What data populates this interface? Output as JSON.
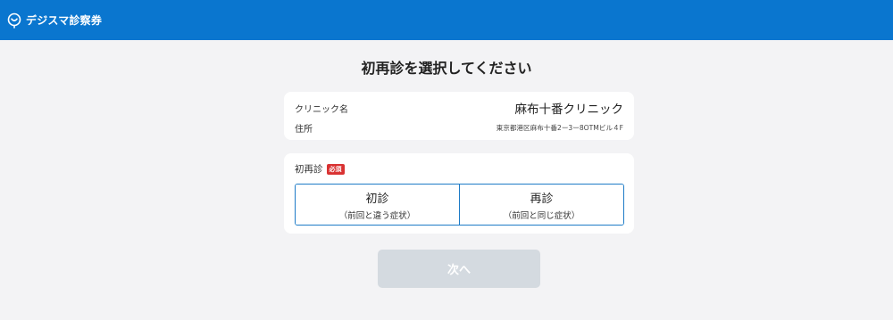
{
  "header": {
    "brand_name": "デジスマ診察券",
    "logo_icon": "location-pin-smile-icon",
    "background_color": "#0a76cf"
  },
  "page": {
    "title": "初再診を選択してください"
  },
  "clinic_info": {
    "clinic_label": "クリニック名",
    "clinic_name": "麻布十番クリニック",
    "address_label": "住所",
    "address": "東京都港区麻布十番2ー3ー8OTMビル４F"
  },
  "visit_type": {
    "label": "初再診",
    "required_badge": "必須",
    "required_color": "#d93232",
    "options": [
      {
        "title": "初診",
        "subtitle": "（前回と違う症状）"
      },
      {
        "title": "再診",
        "subtitle": "（前回と同じ症状）"
      }
    ]
  },
  "actions": {
    "next_label": "次へ"
  }
}
